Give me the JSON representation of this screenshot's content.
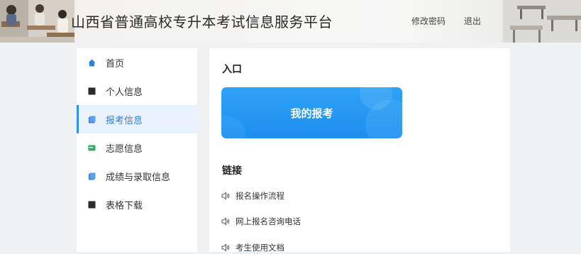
{
  "header": {
    "title": "山西省普通高校专升本考试信息服务平台",
    "change_password": "修改密码",
    "logout": "退出"
  },
  "sidebar": {
    "items": [
      {
        "label": "首页",
        "icon": "home-icon"
      },
      {
        "label": "个人信息",
        "icon": "square-icon"
      },
      {
        "label": "报考信息",
        "icon": "document-icon",
        "active": true
      },
      {
        "label": "志愿信息",
        "icon": "card-icon"
      },
      {
        "label": "成绩与录取信息",
        "icon": "document-icon"
      },
      {
        "label": "表格下载",
        "icon": "square-icon"
      }
    ]
  },
  "main": {
    "entry_title": "入口",
    "entry_button": "我的报考",
    "links_title": "链接",
    "links": [
      {
        "label": "报名操作流程",
        "icon": "speaker-icon"
      },
      {
        "label": "网上报名咨询电话",
        "icon": "speaker-icon"
      },
      {
        "label": "考生使用文档",
        "icon": "speaker-icon"
      }
    ]
  },
  "colors": {
    "accent": "#2f8ef5",
    "active_bg": "#eaf3fd",
    "entry_card": "#1d8ff0"
  }
}
